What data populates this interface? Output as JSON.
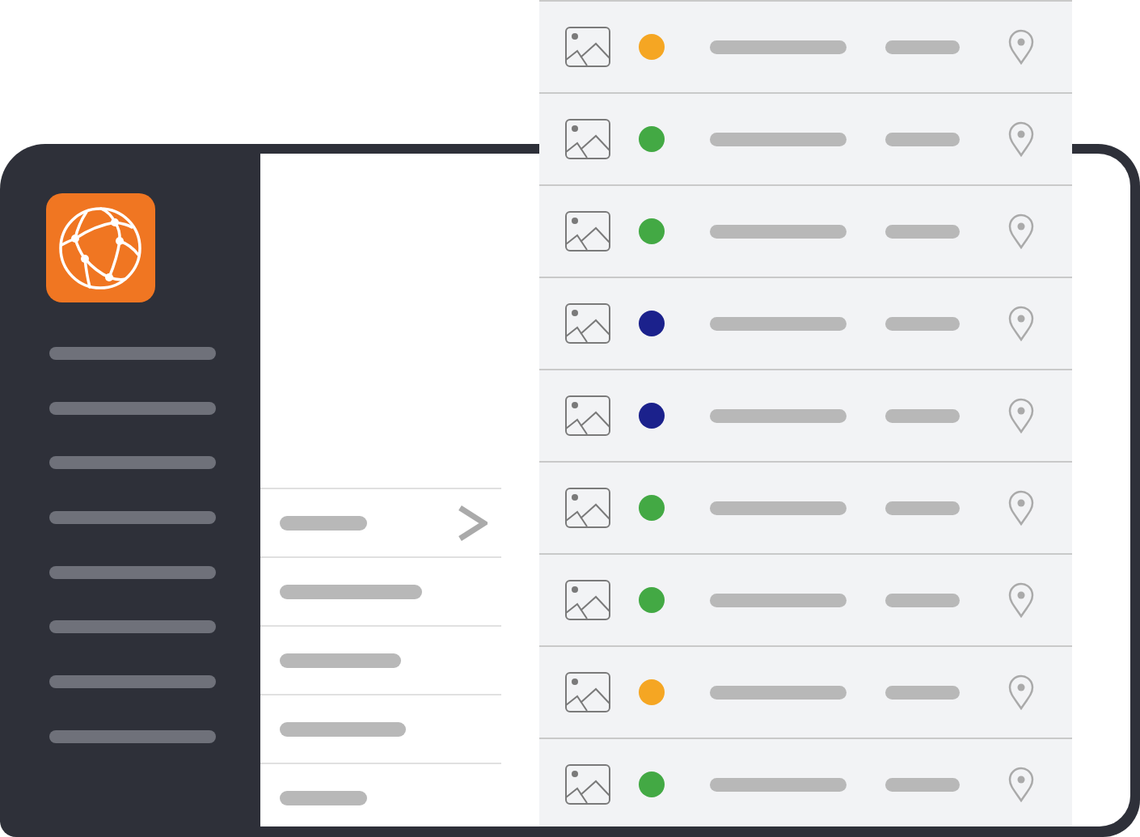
{
  "sidebar": {
    "items": [
      {
        "kind": "line"
      },
      {
        "kind": "line"
      },
      {
        "kind": "line"
      },
      {
        "kind": "line"
      },
      {
        "kind": "line"
      },
      {
        "kind": "line"
      },
      {
        "kind": "line"
      },
      {
        "kind": "line"
      }
    ]
  },
  "content": {
    "list": {
      "items": [
        {
          "kind": "line",
          "expandable": true
        },
        {
          "kind": "line",
          "expandable": false
        },
        {
          "kind": "line",
          "expandable": false
        },
        {
          "kind": "line",
          "expandable": false
        },
        {
          "kind": "line",
          "expandable": false
        }
      ]
    }
  },
  "list_panel": {
    "rows": [
      {
        "color": "#f5a623"
      },
      {
        "color": "#43a944"
      },
      {
        "color": "#43a944"
      },
      {
        "color": "#1b218c"
      },
      {
        "color": "#1b218c"
      },
      {
        "color": "#43a944"
      },
      {
        "color": "#43a944"
      },
      {
        "color": "#f5a623"
      },
      {
        "color": "#43a944"
      }
    ]
  }
}
